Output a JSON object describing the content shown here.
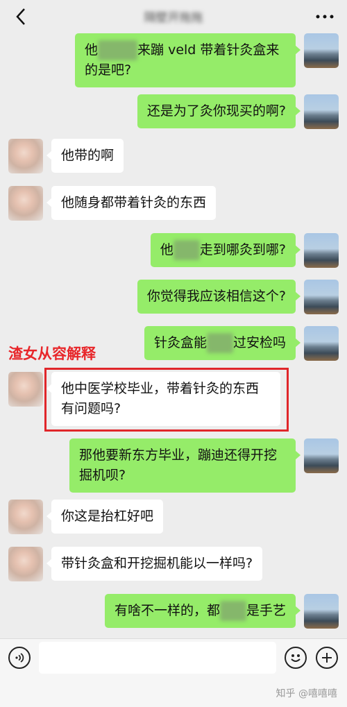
{
  "header": {
    "title": "隔壁开拖拖",
    "back_icon": "chevron-left-icon",
    "more_icon": "more-dots-icon"
  },
  "annotation": "渣女从容解释",
  "messages": [
    {
      "side": "right",
      "parts": [
        "他",
        "[redacted]",
        "来蹦 veld 带着针灸盒来的是吧?"
      ]
    },
    {
      "side": "right",
      "parts": [
        "还是为了灸你现买的啊?"
      ]
    },
    {
      "side": "left",
      "parts": [
        "他带的啊"
      ]
    },
    {
      "side": "left",
      "parts": [
        "他随身都带着针灸的东西"
      ]
    },
    {
      "side": "right",
      "parts": [
        "他",
        "[redacted]",
        "走到哪灸到哪?"
      ]
    },
    {
      "side": "right",
      "parts": [
        "你觉得我应该相信这个?"
      ]
    },
    {
      "side": "right",
      "parts": [
        "针灸盒能",
        "[redacted]",
        "过安检吗"
      ]
    },
    {
      "side": "left",
      "parts": [
        "他中医学校毕业，带着针灸的东西有问题吗?"
      ]
    },
    {
      "side": "right",
      "parts": [
        "那他要新东方毕业，蹦迪还得开挖掘机呗?"
      ]
    },
    {
      "side": "left",
      "parts": [
        "你这是抬杠好吧"
      ]
    },
    {
      "side": "left",
      "parts": [
        "带针灸盒和开挖掘机能以一样吗?"
      ]
    },
    {
      "side": "right",
      "parts": [
        "有啥不一样的，都",
        "[redacted]",
        "是手艺"
      ]
    }
  ],
  "input_bar": {
    "voice_icon": "voice-icon",
    "emoji_icon": "emoji-icon",
    "plus_icon": "plus-icon"
  },
  "watermark": "知乎 @嘻嘻嘻",
  "colors": {
    "self_bubble": "#95ec69",
    "other_bubble": "#ffffff",
    "annotation": "#e8262a"
  }
}
